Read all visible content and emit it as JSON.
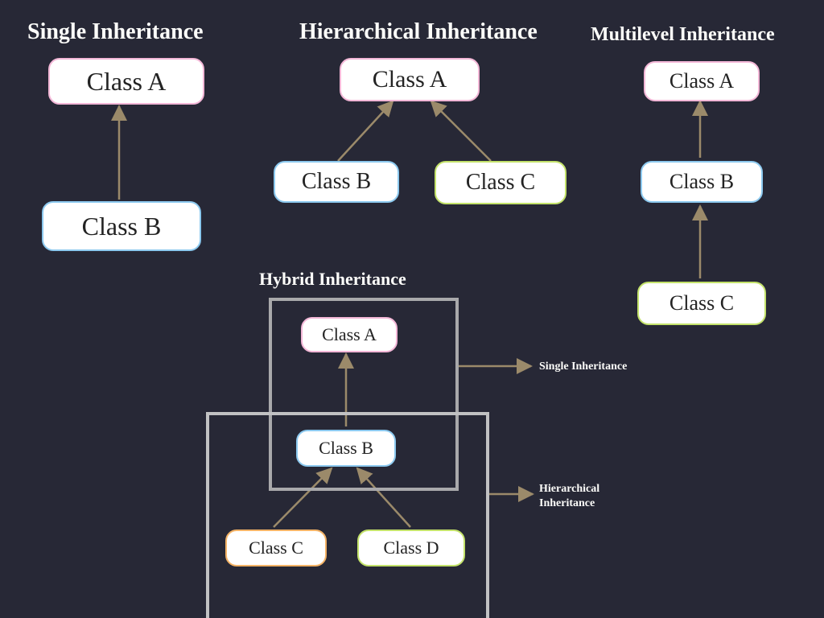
{
  "sections": {
    "single": {
      "title": "Single Inheritance"
    },
    "hierarchical": {
      "title": "Hierarchical Inheritance"
    },
    "multilevel": {
      "title": "Multilevel Inheritance"
    },
    "hybrid": {
      "title": "Hybrid Inheritance"
    }
  },
  "nodes": {
    "single_A": "Class A",
    "single_B": "Class B",
    "hier_A": "Class A",
    "hier_B": "Class B",
    "hier_C": "Class C",
    "multi_A": "Class A",
    "multi_B": "Class B",
    "multi_C": "Class C",
    "hybrid_A": "Class A",
    "hybrid_B": "Class B",
    "hybrid_C": "Class C",
    "hybrid_D": "Class D"
  },
  "labels": {
    "hybrid_single": "Single Inheritance",
    "hybrid_hier_line1": "Hierarchical",
    "hybrid_hier_line2": "Inheritance"
  },
  "colors": {
    "bg": "#272836",
    "pink": "#f3b7d7",
    "blue": "#8cc9ef",
    "green": "#c3e26a",
    "orange": "#f4b366",
    "arrow": "#9b8a6a",
    "frame": "#a9a9ab",
    "text": "#fdfdfa"
  }
}
